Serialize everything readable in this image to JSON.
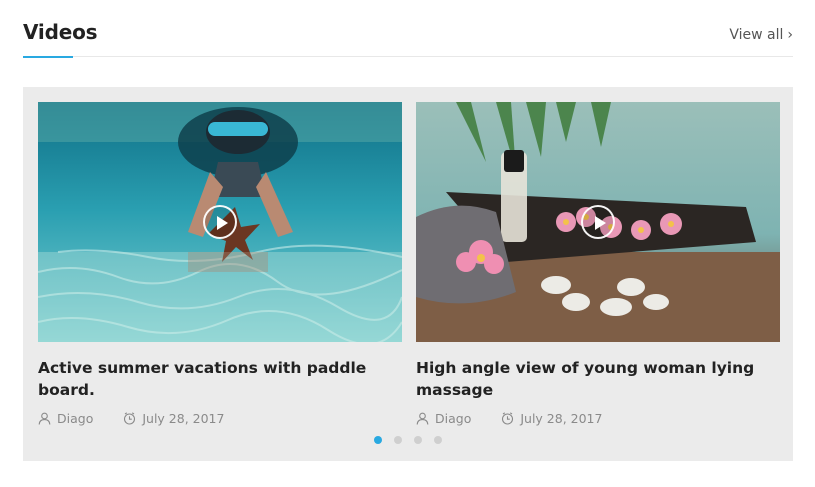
{
  "header": {
    "title": "Videos",
    "view_all": "View all",
    "accent_color": "#29a9e1"
  },
  "videos": [
    {
      "title": "Active summer vacations with paddle board.",
      "author": "Diago",
      "date": "July 28, 2017",
      "thumbnail": "snorkeler-with-starfish-underwater"
    },
    {
      "title": "High angle view of young woman lying massage",
      "author": "Diago",
      "date": "July 28, 2017",
      "thumbnail": "spa-towel-frangipani-stones"
    }
  ],
  "carousel": {
    "dot_count": 4,
    "active_index": 0
  }
}
